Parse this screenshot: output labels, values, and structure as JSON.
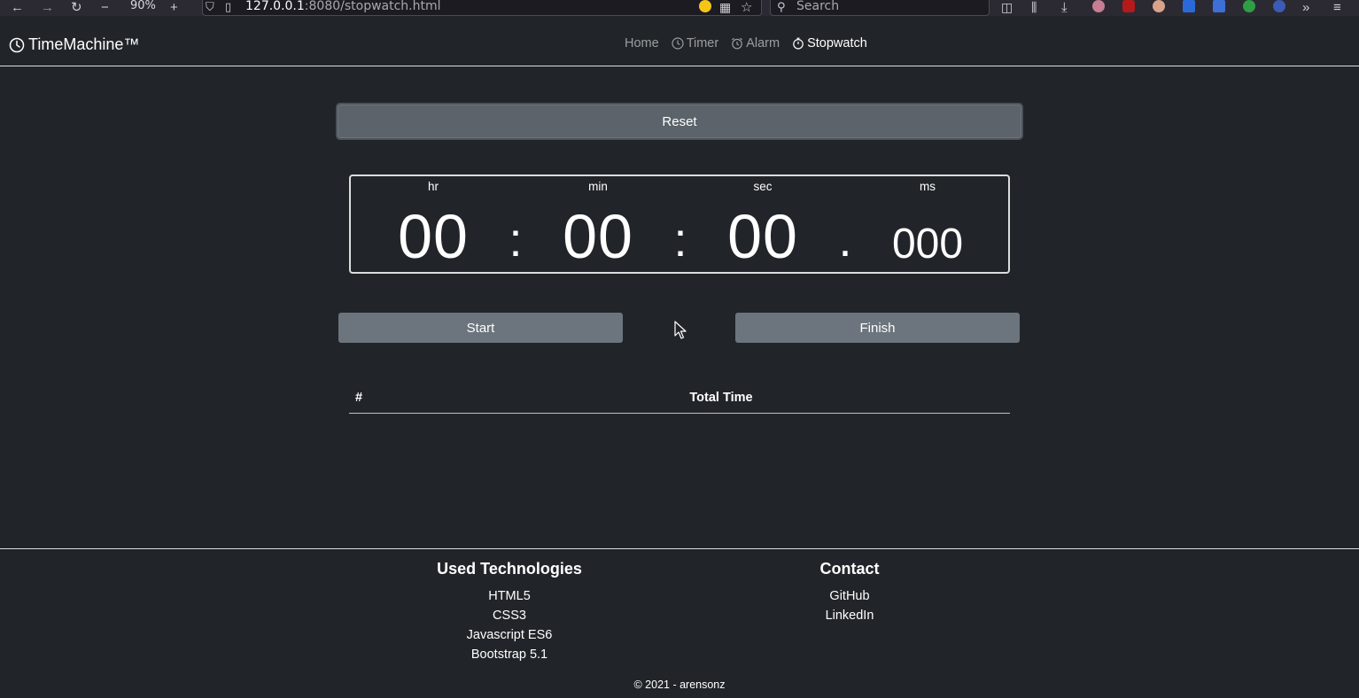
{
  "browser": {
    "zoom": "90%",
    "url_host": "127.0.0.1",
    "url_rest": ":8080/stopwatch.html",
    "search_placeholder": "Search"
  },
  "navbar": {
    "brand": "TimeMachine™",
    "links": [
      {
        "label": "Home"
      },
      {
        "label": "Timer"
      },
      {
        "label": "Alarm"
      },
      {
        "label": "Stopwatch",
        "active": true
      }
    ]
  },
  "controls": {
    "reset_label": "Reset",
    "start_label": "Start",
    "finish_label": "Finish"
  },
  "stopwatch": {
    "labels": {
      "hr": "hr",
      "min": "min",
      "sec": "sec",
      "ms": "ms"
    },
    "hours": "00",
    "minutes": "00",
    "seconds": "00",
    "milliseconds": "000",
    "sep_colon": ":",
    "sep_dot": "."
  },
  "laps_table": {
    "col_index": "#",
    "col_total": "Total Time"
  },
  "footer": {
    "tech_title": "Used Technologies",
    "tech_items": [
      "HTML5",
      "CSS3",
      "Javascript ES6",
      "Bootstrap 5.1"
    ],
    "contact_title": "Contact",
    "contact_items": [
      "GitHub",
      "LinkedIn"
    ],
    "copyright": "© 2021 - arensonz"
  },
  "colors": {
    "page_bg": "#212529",
    "button_secondary": "#6c757d",
    "reset_button": "#5c636a"
  }
}
